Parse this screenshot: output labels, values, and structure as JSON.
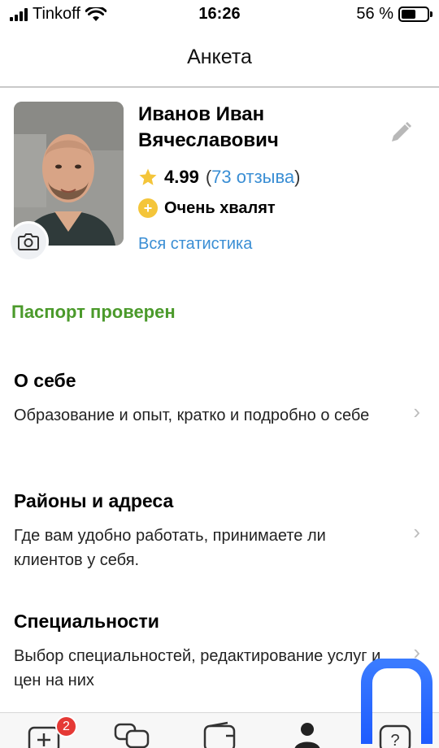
{
  "status_bar": {
    "carrier": "Tinkoff",
    "time": "16:26",
    "battery_percent": "56 %",
    "battery_level": 0.56
  },
  "header": {
    "title": "Анкета"
  },
  "profile": {
    "name": "Иванов Иван Вячеславович",
    "rating": "4.99",
    "reviews_open": "(",
    "reviews_link": "73 отзыва",
    "reviews_close": ")",
    "praise": "Очень хвалят",
    "all_stats": "Вся статистика",
    "passport_status": "Паспорт проверен"
  },
  "sections": [
    {
      "title": "О себе",
      "description": "Образование и опыт, кратко и подробно о себе"
    },
    {
      "title": "Районы и адреса",
      "description": "Где вам удобно работать, принимаете ли клиентов у себя."
    },
    {
      "title": "Специальности",
      "description": "Выбор специальностей, редактирование услуг и цен на них"
    }
  ],
  "tabbar": {
    "badge_count": "2",
    "icons": [
      "add-order-icon",
      "chat-icon",
      "wallet-icon",
      "profile-icon",
      "help-icon"
    ]
  },
  "colors": {
    "link_blue": "#3a8ed4",
    "success_green": "#4b9a2b",
    "star_gold": "#f4c53a",
    "badge_red": "#e53935",
    "logo_blue": "#1e5bff"
  }
}
